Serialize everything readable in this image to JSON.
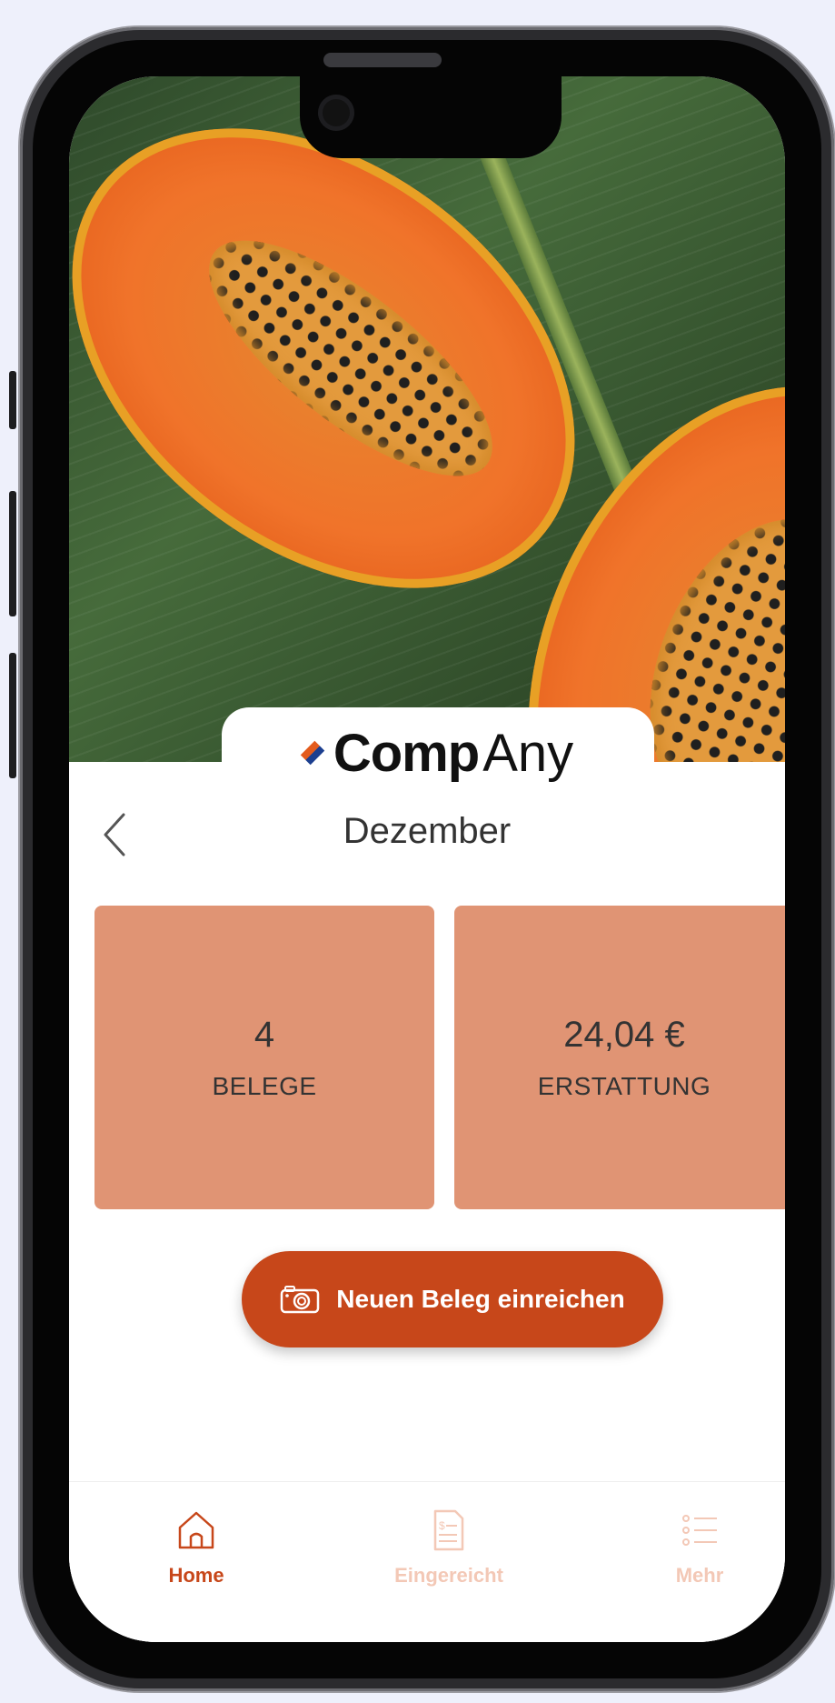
{
  "logo": {
    "part1": "Comp",
    "part2": "Any"
  },
  "header": {
    "month": "Dezember",
    "back_icon": "chevron-left-icon"
  },
  "stats": {
    "receipts": {
      "value": "4",
      "label": "BELEGE"
    },
    "refund": {
      "value": "24,04 €",
      "label": "ERSTATTUNG"
    }
  },
  "cta": {
    "label": "Neuen Beleg einreichen",
    "icon": "camera-icon"
  },
  "tabbar": {
    "items": [
      {
        "label": "Home",
        "icon": "home-icon",
        "active": true
      },
      {
        "label": "Eingereicht",
        "icon": "document-icon",
        "active": false
      },
      {
        "label": "Mehr",
        "icon": "list-icon",
        "active": false
      }
    ]
  },
  "colors": {
    "accent": "#c7471a",
    "card": "#e09474",
    "inactive_tab": "#f3c8b6"
  }
}
